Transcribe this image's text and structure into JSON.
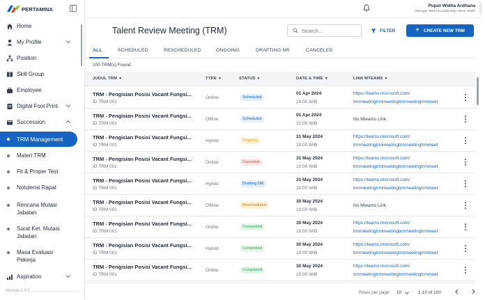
{
  "brand": {
    "name": "PERTAMINA"
  },
  "sidebar": {
    "items": [
      {
        "label": "Home"
      },
      {
        "label": "My Profile"
      },
      {
        "label": "Position"
      },
      {
        "label": "Skill Group"
      },
      {
        "label": "Employee"
      },
      {
        "label": "Digital Foot Print"
      },
      {
        "label": "Succession"
      }
    ],
    "succession_children": [
      {
        "label": "TRM Management"
      },
      {
        "label": "Materi TRM"
      },
      {
        "label": "Fit & Proper Test"
      },
      {
        "label": "Notulensi Rapat"
      },
      {
        "label": "Rencana Mutasi Jabatan"
      },
      {
        "label": "Surat Ket. Mutasi Jabatan"
      },
      {
        "label": "Masa Evaluasi Pekerja"
      }
    ],
    "aspiration": {
      "label": "Aspiration"
    },
    "version": "Version 1.0.1"
  },
  "header": {
    "user_name": "Puput Widha Ardhana",
    "user_role": "Manager Talent & Leadership Admin HCBP"
  },
  "page": {
    "title": "Talent Review Meeting (TRM)",
    "search_placeholder": "Search...",
    "filter_label": "FILTER",
    "create_label": "CREATE NEW TRM",
    "found_text": "100 TRM(s) Found"
  },
  "tabs": [
    {
      "label": "ALL"
    },
    {
      "label": "SCHEDULED"
    },
    {
      "label": "RESCHEDULED"
    },
    {
      "label": "ONGOING"
    },
    {
      "label": "DRAFTING NR"
    },
    {
      "label": "CANCELED"
    }
  ],
  "table": {
    "columns": [
      "JUDUL TRM",
      "TYPE",
      "STATUS",
      "DATE & TIME",
      "LINK MTEAMS"
    ],
    "rows": [
      {
        "title": "TRM - Pengisian Posisi Vacant Fungsi...",
        "id": "ID TRM 001",
        "type": "Online",
        "status": "Scheduled",
        "date": "01 Apr 2024",
        "time": "10:00 WIB",
        "link1": "https://teams.microsoft.com/",
        "link2": "trmmeetingtrmmeetingtrmmeetingtrmmeet"
      },
      {
        "title": "TRM - Pengisian Posisi Vacant Fungsi...",
        "id": "ID TRM 001",
        "type": "Offline",
        "status": "Scheduled",
        "date": "01 Apr 2024",
        "time": "10:00 WIB",
        "nolink": "No Mteams Link"
      },
      {
        "title": "TRM - Pengisian Posisi Vacant Fungsi...",
        "id": "ID TRM 001",
        "type": "Hybrid",
        "status": "Ongoing",
        "date": "31 May 2024",
        "time": "10:00 WIB",
        "link1": "https://teams.microsoft.com/",
        "link2": "trmmeetingtrmmeetingtrmmeetingtrmmeet"
      },
      {
        "title": "TRM - Pengisian Posisi Vacant Fungsi...",
        "id": "ID TRM 001",
        "type": "Online",
        "status": "Canceled",
        "date": "31 May 2024",
        "time": "10:00 WIB",
        "link1": "https://teams.microsoft.com/",
        "link2": "trmmeetingtrmmeetingtrmmeetingtrmmeet"
      },
      {
        "title": "TRM - Pengisian Posisi Vacant Fungsi...",
        "id": "ID TRM 001",
        "type": "Hybrid",
        "status": "Drafting NR",
        "date": "31 May 2024",
        "time": "10:00 WIB",
        "link1": "https://teams.microsoft.com/",
        "link2": "trmmeetingtrmmeetingtrmmeetingtrmmeet"
      },
      {
        "title": "TRM - Pengisian Posisi Vacant Fungsi...",
        "id": "ID TRM 001",
        "type": "Offline",
        "status": "Rescheduled",
        "date": "30 May 2024",
        "time": "10:00 WIB",
        "nolink": "No Mteams Link"
      },
      {
        "title": "TRM - Pengisian Posisi Vacant Fungsi...",
        "id": "ID TRM 001",
        "type": "Online",
        "status": "Completed",
        "date": "30 May 2024",
        "time": "10:00 WIB",
        "link1": "https://teams.microsoft.com/",
        "link2": "trmmeetingtrmmeetingtrmmeetingtrmmeet"
      },
      {
        "title": "TRM - Pengisian Posisi Vacant Fungsi...",
        "id": "ID TRM 001",
        "type": "Hybrid",
        "status": "Completed",
        "date": "30 May 2024",
        "time": "10:00 WIB",
        "link1": "https://teams.microsoft.com/",
        "link2": "trmmeetingtrmmeetingtrmmeetingtrmmeet"
      },
      {
        "title": "TRM - Pengisian Posisi Vacant Fungsi...",
        "id": "ID TRM 001",
        "type": "Online",
        "status": "Completed",
        "date": "30 May 2024",
        "time": "10:00 WIB",
        "link1": "https://teams.microsoft.com/",
        "link2": "trmmeetingtrmmeetingtrmmeetingtrmmeet"
      }
    ]
  },
  "status_colors": {
    "Scheduled": {
      "bg": "#e3efff",
      "fg": "#1565c0"
    },
    "Ongoing": {
      "bg": "#fff4e0",
      "fg": "#f59e0b"
    },
    "Canceled": {
      "bg": "#fde8e8",
      "fg": "#e53935"
    },
    "Drafting NR": {
      "bg": "#e3efff",
      "fg": "#1565c0"
    },
    "Rescheduled": {
      "bg": "#fff1d6",
      "fg": "#d97706"
    },
    "Completed": {
      "bg": "#e6f6ea",
      "fg": "#22a447"
    }
  },
  "pagination": {
    "rows_per_page_label": "Rows per page:",
    "rows_per_page": "10",
    "range": "1-10 of 100"
  },
  "colors": {
    "accent": "#1565c0"
  }
}
